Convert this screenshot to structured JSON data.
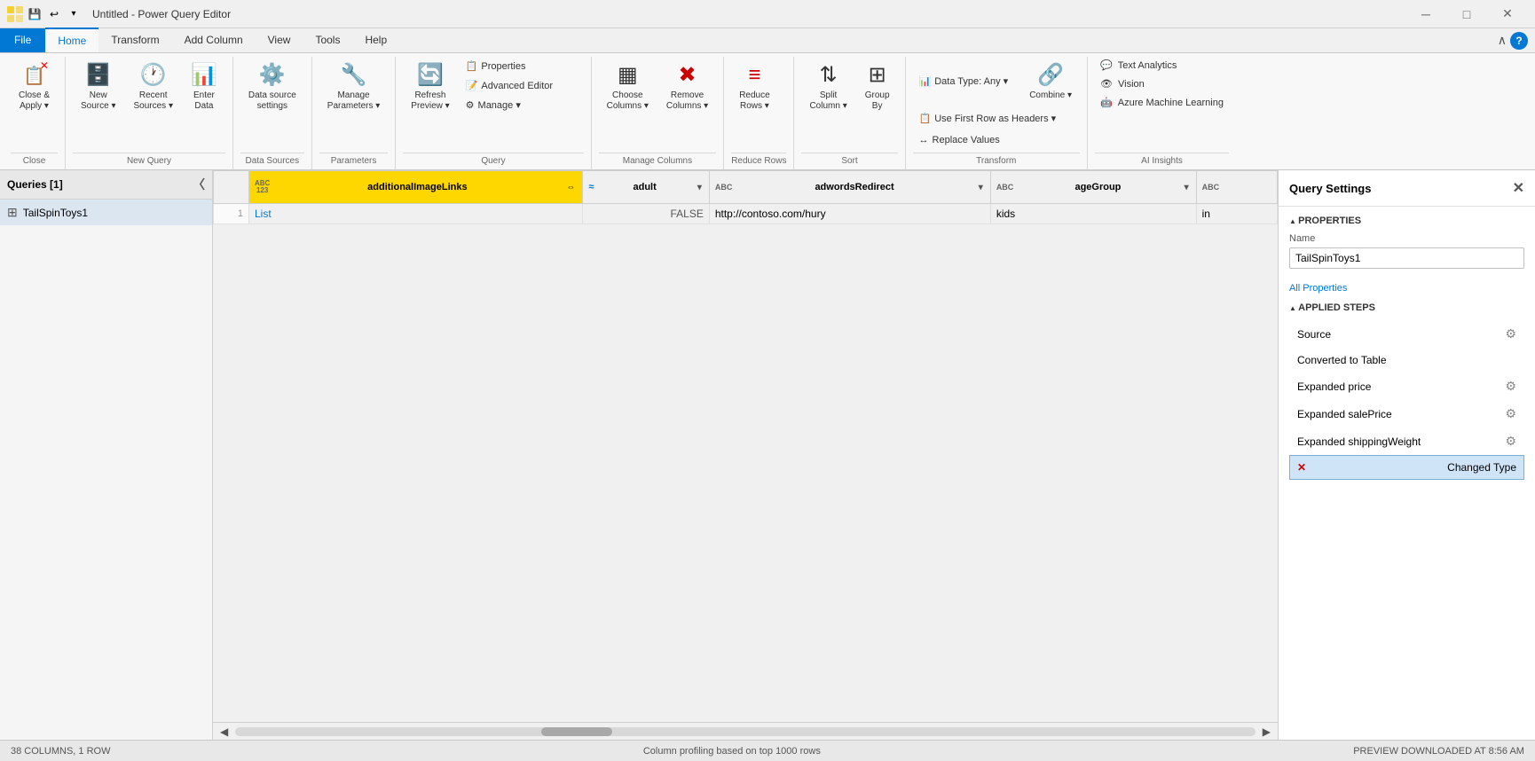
{
  "titleBar": {
    "title": "Untitled - Power Query Editor",
    "minimizeLabel": "─",
    "maximizeLabel": "□",
    "closeLabel": "✕"
  },
  "ribbonTabs": [
    {
      "label": "File",
      "isFile": true
    },
    {
      "label": "Home",
      "active": true
    },
    {
      "label": "Transform"
    },
    {
      "label": "Add Column"
    },
    {
      "label": "View"
    },
    {
      "label": "Tools"
    },
    {
      "label": "Help"
    }
  ],
  "ribbon": {
    "groups": {
      "close": {
        "label": "Close",
        "buttons": [
          {
            "label": "Close &\nApply",
            "sub": "▾"
          }
        ]
      },
      "newQuery": {
        "label": "New Query",
        "buttons": [
          {
            "label": "New\nSource",
            "sub": "▾"
          },
          {
            "label": "Recent\nSources",
            "sub": "▾"
          },
          {
            "label": "Enter\nData"
          }
        ]
      },
      "dataSources": {
        "label": "Data Sources",
        "buttons": [
          {
            "label": "Data source\nsettings"
          }
        ]
      },
      "parameters": {
        "label": "Parameters",
        "buttons": [
          {
            "label": "Manage\nParameters",
            "sub": "▾"
          }
        ]
      },
      "query": {
        "label": "Query",
        "smallButtons": [
          {
            "label": "Properties"
          },
          {
            "label": "Advanced Editor"
          },
          {
            "label": "Manage",
            "sub": "▾"
          }
        ],
        "largeButton": {
          "label": "Refresh\nPreview",
          "sub": "▾"
        }
      },
      "manageColumns": {
        "label": "Manage Columns",
        "buttons": [
          {
            "label": "Choose\nColumns",
            "sub": "▾"
          },
          {
            "label": "Remove\nColumns",
            "sub": "▾"
          }
        ]
      },
      "reduceRows": {
        "label": "Reduce Rows",
        "buttons": [
          {
            "label": "Reduce\nRows",
            "sub": "▾"
          }
        ]
      },
      "sort": {
        "label": "Sort",
        "buttons": [
          {
            "label": "Split\nColumn",
            "sub": "▾"
          },
          {
            "label": "Group\nBy"
          }
        ]
      },
      "transform": {
        "label": "Transform",
        "topRow": [
          {
            "label": "Data Type: Any",
            "sub": "▾"
          },
          {
            "label": "Combine",
            "sub": "▾"
          }
        ],
        "midRow": [
          {
            "label": "Use First Row as Headers",
            "sub": "▾"
          }
        ],
        "botRow": [
          {
            "label": "Replace Values"
          }
        ]
      },
      "aiInsights": {
        "label": "AI Insights",
        "items": [
          {
            "label": "Text Analytics"
          },
          {
            "label": "Vision"
          },
          {
            "label": "Azure Machine Learning"
          }
        ]
      }
    }
  },
  "queriesPanel": {
    "title": "Queries [1]",
    "items": [
      {
        "name": "TailSpinToys1",
        "icon": "⊞"
      }
    ]
  },
  "table": {
    "columns": [
      {
        "name": "additionalImageLinks",
        "type": "ABC\n123",
        "selected": true
      },
      {
        "name": "adult",
        "type": "≈",
        "hasFilter": true
      },
      {
        "name": "adwordsRedirect",
        "type": "ABC",
        "hasFilter": true
      },
      {
        "name": "ageGroup",
        "type": "ABC",
        "hasFilter": true
      },
      {
        "name": "...",
        "type": "ABC",
        "hasFilter": false
      }
    ],
    "rows": [
      {
        "num": "1",
        "cols": [
          "List",
          "FALSE",
          "http://contoso.com/hury",
          "kids",
          "in"
        ]
      }
    ]
  },
  "querySettings": {
    "title": "Query Settings",
    "propertiesSection": {
      "title": "PROPERTIES",
      "nameLabel": "Name",
      "nameValue": "TailSpinToys1",
      "allPropertiesLink": "All Properties"
    },
    "appliedStepsSection": {
      "title": "APPLIED STEPS",
      "steps": [
        {
          "label": "Source",
          "hasGear": true,
          "active": false,
          "hasError": false
        },
        {
          "label": "Converted to Table",
          "hasGear": false,
          "active": false,
          "hasError": false
        },
        {
          "label": "Expanded price",
          "hasGear": true,
          "active": false,
          "hasError": false
        },
        {
          "label": "Expanded salePrice",
          "hasGear": true,
          "active": false,
          "hasError": false
        },
        {
          "label": "Expanded shippingWeight",
          "hasGear": true,
          "active": false,
          "hasError": false
        },
        {
          "label": "Changed Type",
          "hasGear": false,
          "active": true,
          "hasError": true
        }
      ]
    }
  },
  "statusBar": {
    "left": "38 COLUMNS, 1 ROW",
    "middle": "Column profiling based on top 1000 rows",
    "right": "PREVIEW DOWNLOADED AT 8:56 AM"
  }
}
